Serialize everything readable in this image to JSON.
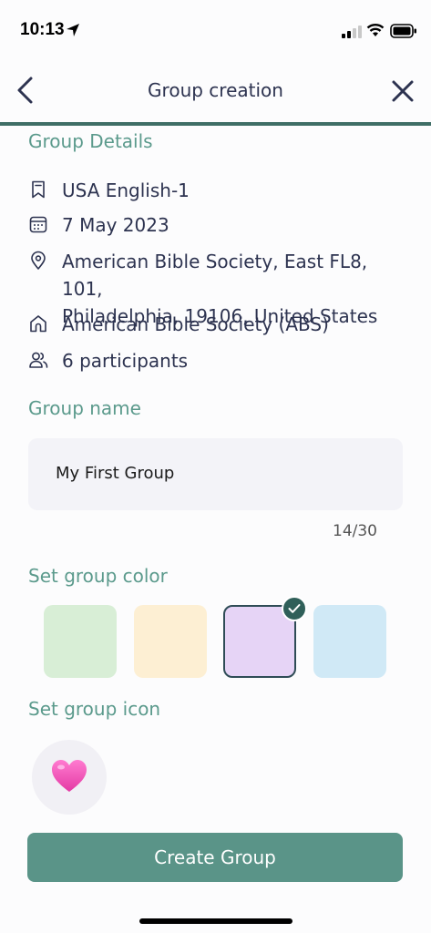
{
  "status_bar": {
    "time": "10:13"
  },
  "header": {
    "title": "Group creation"
  },
  "group_details": {
    "section_title": "Group Details",
    "language": "USA English-1",
    "date": "7 May 2023",
    "address_line1": "American Bible Society, East FL8, 101,",
    "address_line2": "Philadelphia, 19106, United States",
    "organization": "American Bible Society (ABS)",
    "participants": "6 participants"
  },
  "group_name": {
    "section_title": "Group name",
    "value": "My First Group",
    "counter": "14/30"
  },
  "group_color": {
    "section_title": "Set group color",
    "options": [
      {
        "name": "green",
        "hex": "#d8eed6",
        "selected": false
      },
      {
        "name": "yellow",
        "hex": "#fdefd3",
        "selected": false
      },
      {
        "name": "purple",
        "hex": "#e6d4f6",
        "selected": true
      },
      {
        "name": "blue",
        "hex": "#d0e9f6",
        "selected": false
      }
    ]
  },
  "group_icon": {
    "section_title": "Set group icon",
    "selected_icon": "pink-heart-icon"
  },
  "actions": {
    "create_label": "Create Group"
  },
  "colors": {
    "accent": "#5a9488",
    "heading": "#5b9a8c",
    "divider": "#3f6e66"
  }
}
